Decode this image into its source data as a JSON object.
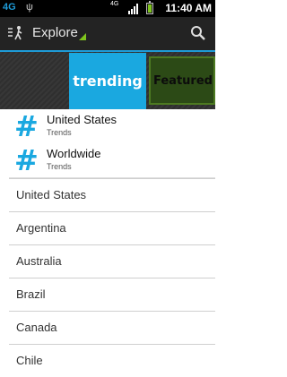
{
  "status_bar": {
    "network": "4G",
    "network_mode": "4G",
    "time": "11:40 AM",
    "battery_level": 1.0
  },
  "action_bar": {
    "title": "Explore"
  },
  "carousel": {
    "active_tab": "trending",
    "inactive_tab": "Featured"
  },
  "trend_locations": [
    {
      "title": "United States",
      "subtitle": "Trends"
    },
    {
      "title": "Worldwide",
      "subtitle": "Trends"
    }
  ],
  "countries": [
    "United States",
    "Argentina",
    "Australia",
    "Brazil",
    "Canada",
    "Chile"
  ],
  "colors": {
    "accent": "#1aa8e0",
    "action_bar": "#232323",
    "featured_tab": "#2c4a16"
  }
}
